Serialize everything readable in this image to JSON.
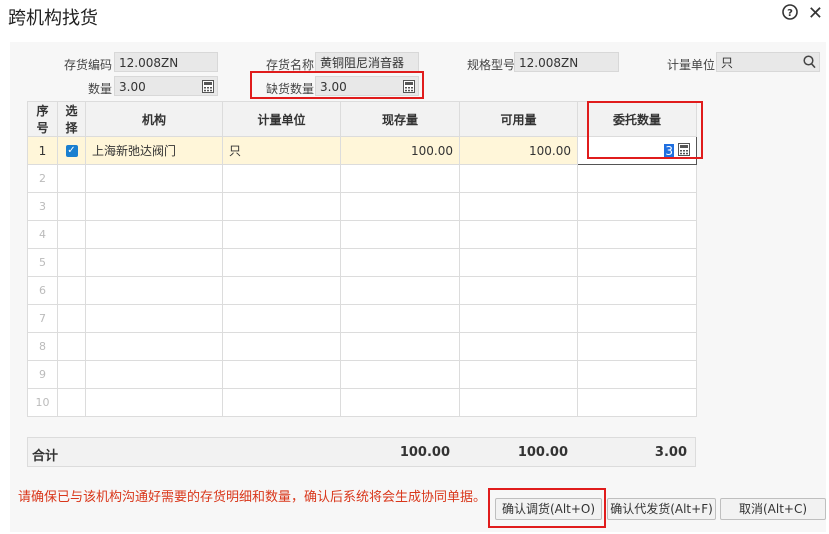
{
  "window": {
    "title": "跨机构找货",
    "help_icon": "?",
    "close_icon": "✕"
  },
  "form": {
    "item_code_label": "存货编码",
    "item_code_value": "12.008ZN",
    "item_name_label": "存货名称",
    "item_name_value": "黄铜阻尼消音器",
    "spec_label": "规格型号",
    "spec_value": "12.008ZN",
    "unit_label": "计量单位",
    "unit_value": "只",
    "qty_label": "数量",
    "qty_value": "3.00",
    "shortage_label": "缺货数量",
    "shortage_value": "3.00"
  },
  "table": {
    "headers": [
      "序号",
      "选择",
      "机构",
      "计量单位",
      "现存量",
      "可用量",
      "委托数量"
    ],
    "rows": [
      {
        "no": "1",
        "checked": true,
        "org": "上海新弛达阀门",
        "unit": "只",
        "stock": "100.00",
        "available": "100.00",
        "entrust": "3"
      },
      {
        "no": "2"
      },
      {
        "no": "3"
      },
      {
        "no": "4"
      },
      {
        "no": "5"
      },
      {
        "no": "6"
      },
      {
        "no": "7"
      },
      {
        "no": "8"
      },
      {
        "no": "9"
      },
      {
        "no": "10"
      }
    ],
    "total": {
      "label": "合计",
      "stock": "100.00",
      "available": "100.00",
      "entrust": "3.00"
    }
  },
  "note": "请确保已与该机构沟通好需要的存货明细和数量，确认后系统将会生成协同单据。",
  "buttons": {
    "confirm_transfer": "确认调货(Alt+O)",
    "confirm_ship": "确认代发货(Alt+F)",
    "cancel": "取消(Alt+C)"
  },
  "colors": {
    "highlight_box": "#e01c1c",
    "note_text": "#d9371b",
    "checkbox": "#1a7fd0",
    "selected_row": "#fff6d9"
  }
}
